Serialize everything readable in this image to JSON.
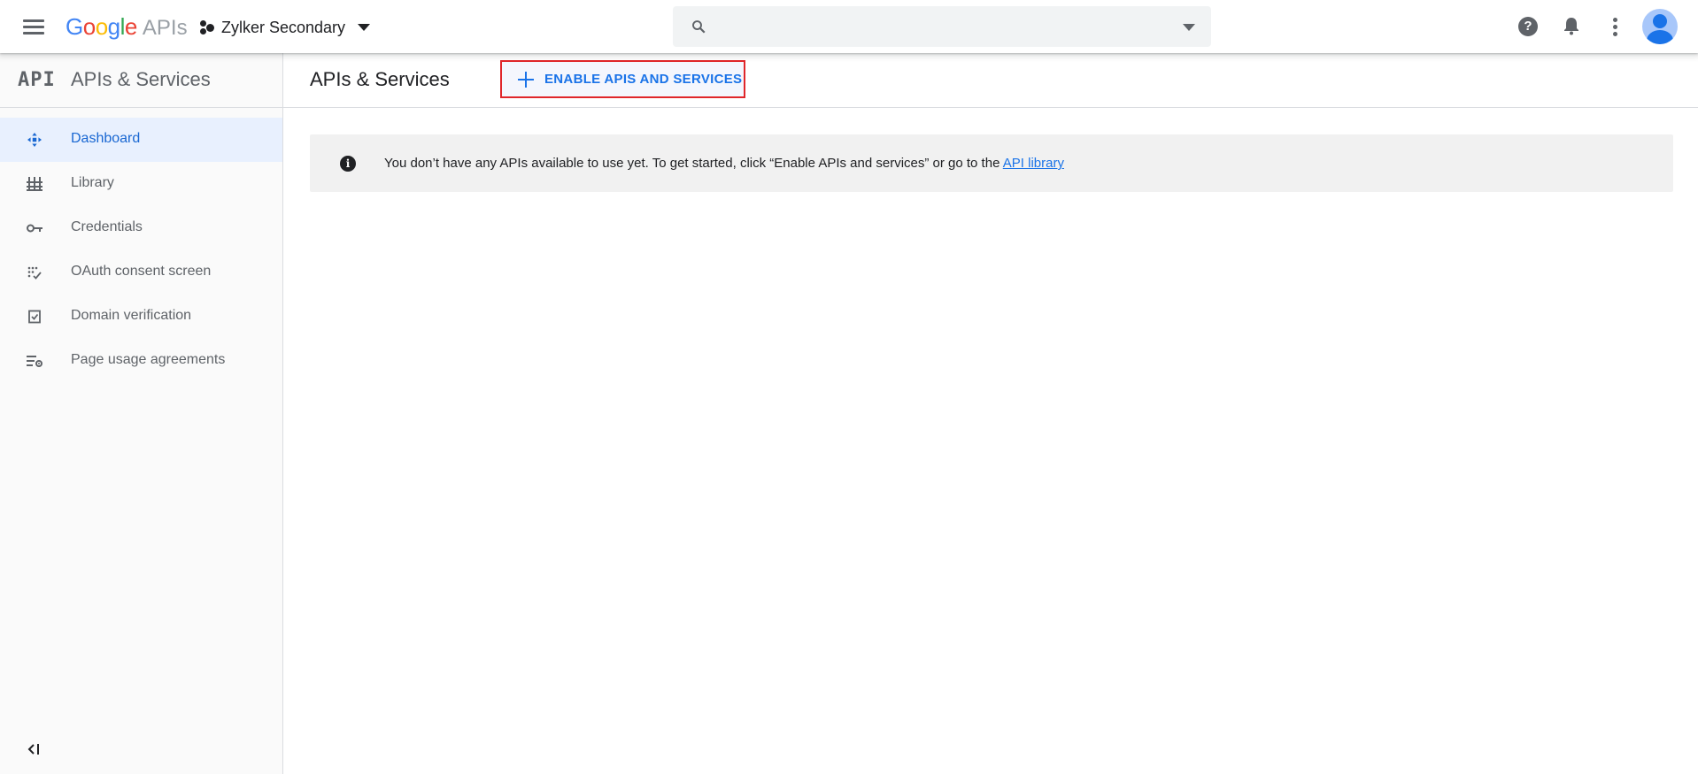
{
  "topbar": {
    "logo_google": "Google",
    "logo_apis": "APIs",
    "project_name": "Zylker Secondary",
    "search_value": "",
    "search_placeholder": "",
    "help_icon_glyph": "?"
  },
  "sidebar": {
    "logo": "API",
    "title": "APIs & Services",
    "items": [
      {
        "label": "Dashboard",
        "icon": "dashboard-icon",
        "active": true
      },
      {
        "label": "Library",
        "icon": "library-icon",
        "active": false
      },
      {
        "label": "Credentials",
        "icon": "key-icon",
        "active": false
      },
      {
        "label": "OAuth consent screen",
        "icon": "oauth-icon",
        "active": false
      },
      {
        "label": "Domain verification",
        "icon": "checkbox-icon",
        "active": false
      },
      {
        "label": "Page usage agreements",
        "icon": "settings-list-icon",
        "active": false
      }
    ],
    "collapse_icon": "collapse-left-icon"
  },
  "main": {
    "title": "APIs & Services",
    "enable_button": "ENABLE APIS AND SERVICES",
    "info_icon_glyph": "i",
    "info_text": "You don’t have any APIs available to use yet. To get started, click “Enable APIs and services” or go to the ",
    "info_link": "API library"
  },
  "colors": {
    "accent": "#1a73e8",
    "active_bg": "#e8f0fe",
    "highlight_border": "#e0262a",
    "info_bg": "#f1f1f1"
  }
}
